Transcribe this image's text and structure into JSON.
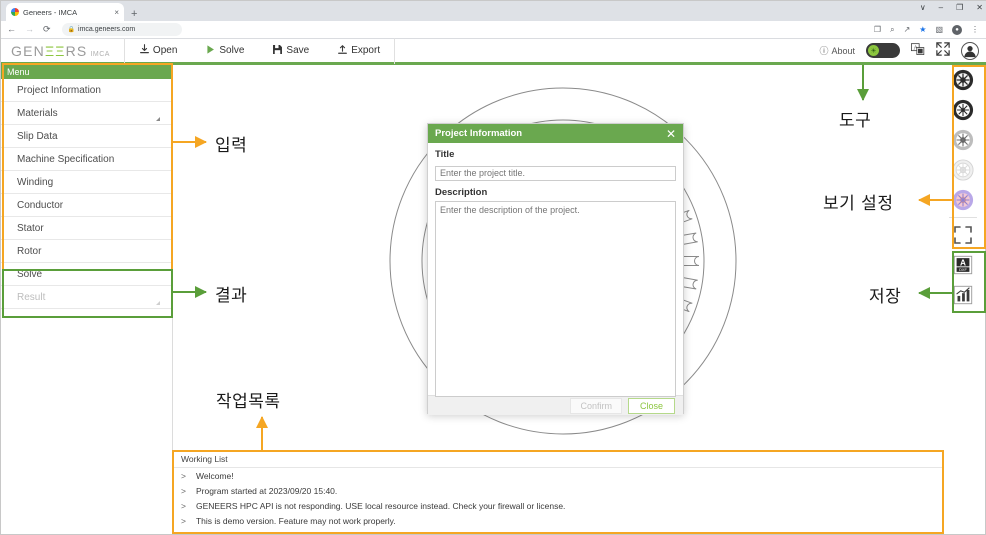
{
  "browser": {
    "tab": {
      "title": "Geneers - IMCA",
      "close_icon": "×",
      "favicon": "chrome-logo-icon"
    },
    "new_tab_label": "+",
    "window_controls": [
      "∨",
      "–",
      "❐",
      "✕"
    ],
    "nav": {
      "back": "←",
      "forward": "→",
      "reload": "⟳"
    },
    "address": {
      "lock": "🔒",
      "url": "imca.geneers.com"
    },
    "toolbar_icons": [
      "cast-icon",
      "zoom-icon",
      "share-icon",
      "bookmark-star-icon",
      "sidepanel-icon",
      "profile-icon",
      "kebab-menu-icon"
    ],
    "toolbar_glyphs": [
      "❐",
      "⌕",
      "↗",
      "★",
      "▧",
      "●",
      "⋮"
    ]
  },
  "app": {
    "logo": {
      "part1": "GEN",
      "part2": "ΞΞ",
      "part3": "RS",
      "sub": "IMCA"
    },
    "toolbar": [
      {
        "label": "Open",
        "icon": "⤓",
        "name": "open-button"
      },
      {
        "label": "Solve",
        "icon": "▶",
        "name": "solve-button"
      },
      {
        "label": "Save",
        "icon": "■",
        "name": "save-button"
      },
      {
        "label": "Export",
        "icon": "⤒",
        "name": "export-button"
      }
    ],
    "header_right": {
      "about_label": "About",
      "about_icon": "ⓘ",
      "theme_toggle": "theme-toggle",
      "language_icon": "ᴬ",
      "fullscreen_icon": "fullscreen-icon",
      "avatar_icon": "●"
    }
  },
  "sidebar": {
    "header": "Menu",
    "items": [
      {
        "label": "Project Information",
        "caret": false,
        "disabled": false
      },
      {
        "label": "Materials",
        "caret": true,
        "disabled": false
      },
      {
        "label": "Slip Data",
        "caret": false,
        "disabled": false
      },
      {
        "label": "Machine Specification",
        "caret": false,
        "disabled": false
      },
      {
        "label": "Winding",
        "caret": false,
        "disabled": false
      },
      {
        "label": "Conductor",
        "caret": false,
        "disabled": false
      },
      {
        "label": "Stator",
        "caret": false,
        "disabled": false
      },
      {
        "label": "Rotor",
        "caret": false,
        "disabled": false
      },
      {
        "label": "Solve",
        "caret": false,
        "disabled": false
      },
      {
        "label": "Result",
        "caret": true,
        "disabled": true
      }
    ]
  },
  "dialog": {
    "title": "Project Information",
    "close_icon": "✕",
    "title_label": "Title",
    "title_placeholder": "Enter the project title.",
    "description_label": "Description",
    "description_placeholder": "Enter the description of the project.",
    "confirm_label": "Confirm",
    "close_label": "Close"
  },
  "rail": {
    "view_buttons": [
      {
        "name": "view-full-machine-icon",
        "tone": "dark"
      },
      {
        "name": "view-stator-rotor-icon",
        "tone": "dark"
      },
      {
        "name": "view-stator-icon",
        "tone": "mid"
      },
      {
        "name": "view-outline-icon",
        "tone": "light"
      },
      {
        "name": "view-flux-color-icon",
        "tone": "color"
      }
    ],
    "fit_icon": "fit-to-screen-icon",
    "save_buttons": [
      {
        "name": "export-dxf-icon",
        "label": "DXF"
      },
      {
        "name": "export-chart-icon",
        "label": "chart"
      }
    ]
  },
  "working_list": {
    "title": "Working List",
    "bullet": ">",
    "rows": [
      "Welcome!",
      "Program started at 2023/09/20 15:40.",
      "GENEERS HPC API is not responding. USE local resource instead. Check your firewall or license.",
      "This is demo version. Feature may not work properly."
    ]
  },
  "annotations": [
    {
      "label": "입력",
      "color": "#f5a623",
      "name": "annotation-input"
    },
    {
      "label": "결과",
      "color": "#5a9e3a",
      "name": "annotation-result"
    },
    {
      "label": "도구",
      "color": "#5a9e3a",
      "name": "annotation-tools"
    },
    {
      "label": "보기 설정",
      "color": "#f5a623",
      "name": "annotation-view-settings"
    },
    {
      "label": "저장",
      "color": "#5a9e3a",
      "name": "annotation-save"
    },
    {
      "label": "작업목록",
      "color": "#f5a623",
      "name": "annotation-working-list"
    }
  ],
  "colors": {
    "brand_green": "#6aa84f",
    "logo_green": "#8cc63f",
    "accent_orange": "#f5a623",
    "anno_green": "#5a9e3a"
  }
}
